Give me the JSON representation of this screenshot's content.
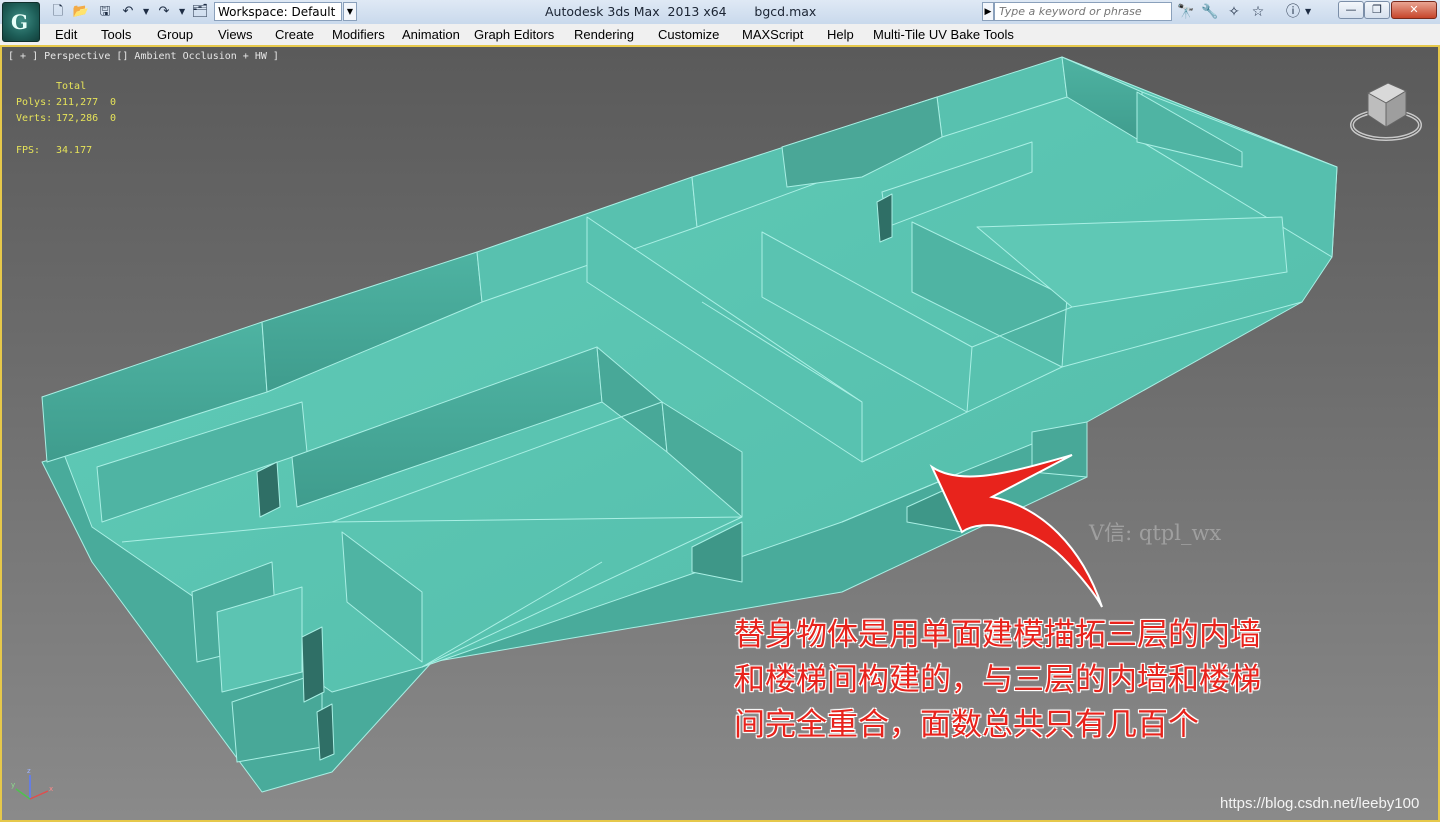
{
  "titlebar": {
    "app_logo_text": "G",
    "workspace": "Workspace: Default",
    "window_title": "Autodesk 3ds Max  2013 x64       bgcd.max",
    "search_placeholder": "Type a keyword or phrase",
    "icons": [
      "new-file-icon",
      "open-folder-icon",
      "save-icon",
      "undo-icon",
      "redo-icon",
      "project-folder-icon",
      "binoculars-icon",
      "communication-icon",
      "favorites-icon",
      "star-icon",
      "help-icon"
    ],
    "window_buttons": [
      "minimize",
      "restore",
      "close"
    ]
  },
  "menu": {
    "items": [
      "Edit",
      "Tools",
      "Group",
      "Views",
      "Create",
      "Modifiers",
      "Animation",
      "Graph Editors",
      "Rendering",
      "Customize",
      "MAXScript",
      "Help",
      "Multi-Tile UV Bake Tools"
    ]
  },
  "viewport": {
    "label": "[ + ] Perspective [] Ambient Occlusion + HW ]",
    "stats": {
      "total_header": "Total",
      "polys_label": "Polys:",
      "polys_value": "211,277",
      "polys_extra": "0",
      "verts_label": "Verts:",
      "verts_value": "172,286",
      "verts_extra": "0",
      "fps_label": "FPS:",
      "fps_value": "34.177"
    },
    "watermark": "V信: qtpl_wx",
    "url_watermark": "https://blog.csdn.net/leeby100",
    "annotation_lines": [
      "替身物体是用单面建模描拓三层的内墙",
      "和楼梯间构建的，与三层的内墙和楼梯",
      "间完全重合，面数总共只有几百个"
    ],
    "colors": {
      "mesh_fill": "#5cc4b2",
      "mesh_dark": "#3c9a8c",
      "mesh_edge": "#a9efe4",
      "annotation": "#e8231c",
      "viewport_border": "#e6c84a"
    }
  }
}
